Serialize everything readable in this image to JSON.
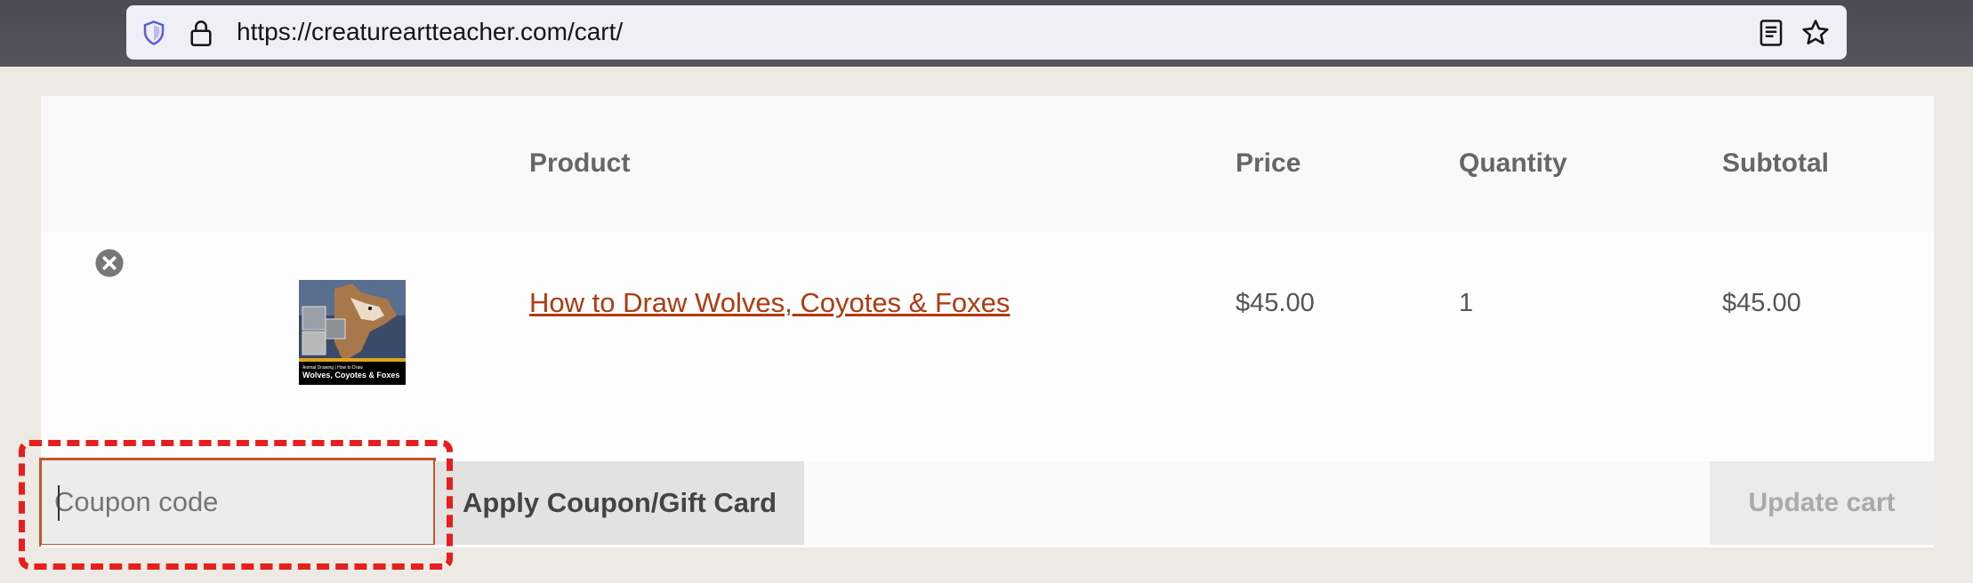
{
  "browser": {
    "url": "https://creatureartteacher.com/cart/",
    "icons": [
      "shield-icon",
      "lock-icon",
      "reader-view-icon",
      "bookmark-star-icon"
    ]
  },
  "cart": {
    "columns": {
      "product": "Product",
      "price": "Price",
      "quantity": "Quantity",
      "subtotal": "Subtotal"
    },
    "items": [
      {
        "name": "How to Draw Wolves, Coyotes & Foxes",
        "price": "$45.00",
        "quantity": "1",
        "subtotal": "$45.00",
        "thumbnail_caption_small": "Animal Drawing | How to Draw",
        "thumbnail_caption": "Wolves, Coyotes & Foxes"
      }
    ],
    "coupon_placeholder": "Coupon code",
    "apply_label": "Apply Coupon/Gift Card",
    "update_label": "Update cart"
  },
  "colors": {
    "link": "#b23a12",
    "highlight": "#e51f1f"
  }
}
